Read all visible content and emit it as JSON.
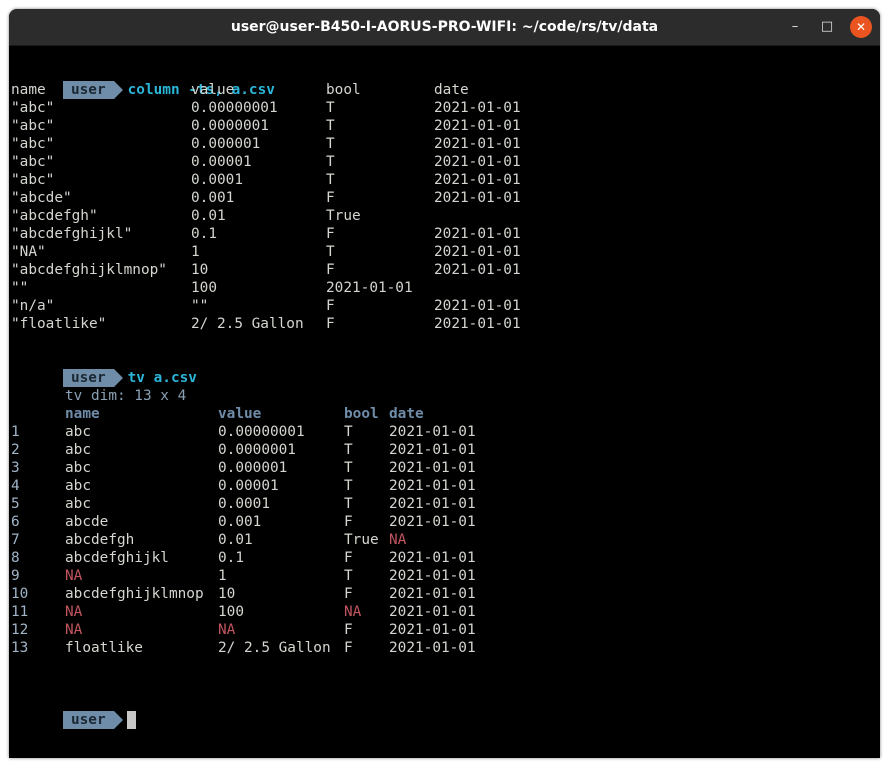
{
  "window": {
    "title": "user@user-B450-I-AORUS-PRO-WIFI: ~/code/rs/tv/data",
    "min_label": "–",
    "max_label": "□",
    "close_label": "✕"
  },
  "prompt": {
    "user": "user"
  },
  "cmd1": "column -ts, a.csv",
  "col_output": {
    "header": [
      "name",
      "value",
      "bool",
      "date"
    ],
    "rows": [
      [
        "\"abc\"",
        "0.00000001",
        "T",
        "2021-01-01"
      ],
      [
        "\"abc\"",
        "0.0000001",
        "T",
        "2021-01-01"
      ],
      [
        "\"abc\"",
        "0.000001",
        "T",
        "2021-01-01"
      ],
      [
        "\"abc\"",
        "0.00001",
        "T",
        "2021-01-01"
      ],
      [
        "\"abc\"",
        "0.0001",
        "T",
        "2021-01-01"
      ],
      [
        "\"abcde\"",
        "0.001",
        "F",
        "2021-01-01"
      ],
      [
        "\"abcdefgh\"",
        "0.01",
        "True",
        ""
      ],
      [
        "\"abcdefghijkl\"",
        "0.1",
        "F",
        "2021-01-01"
      ],
      [
        "\"NA\"",
        "1",
        "T",
        "2021-01-01"
      ],
      [
        "\"abcdefghijklmnop\"",
        "10",
        "F",
        "2021-01-01"
      ],
      [
        "\"\"",
        "100",
        "2021-01-01",
        ""
      ],
      [
        "\"n/a\"",
        "\"\"",
        "F",
        "2021-01-01"
      ],
      [
        "\"floatlike\"",
        "2/ 2.5 Gallon",
        "F",
        "2021-01-01"
      ]
    ]
  },
  "cmd2": "tv a.csv",
  "tv_output": {
    "dim": "tv dim: 13 x 4",
    "header": [
      "name",
      "value",
      "bool",
      "date"
    ],
    "rows": [
      [
        "1",
        "abc",
        "0.00000001",
        "T",
        "2021-01-01"
      ],
      [
        "2",
        "abc",
        "0.0000001",
        "T",
        "2021-01-01"
      ],
      [
        "3",
        "abc",
        "0.000001",
        "T",
        "2021-01-01"
      ],
      [
        "4",
        "abc",
        "0.00001",
        "T",
        "2021-01-01"
      ],
      [
        "5",
        "abc",
        "0.0001",
        "T",
        "2021-01-01"
      ],
      [
        "6",
        "abcde",
        "0.001",
        "F",
        "2021-01-01"
      ],
      [
        "7",
        "abcdefgh",
        "0.01",
        "True",
        "NA"
      ],
      [
        "8",
        "abcdefghijkl",
        "0.1",
        "F",
        "2021-01-01"
      ],
      [
        "9",
        "NA",
        "1",
        "T",
        "2021-01-01"
      ],
      [
        "10",
        "abcdefghijklmnop",
        "10",
        "F",
        "2021-01-01"
      ],
      [
        "11",
        "NA",
        "100",
        "NA",
        "2021-01-01"
      ],
      [
        "12",
        "NA",
        "NA",
        "F",
        "2021-01-01"
      ],
      [
        "13",
        "floatlike",
        "2/ 2.5 Gallon",
        "F",
        "2021-01-01"
      ]
    ],
    "na_token": "NA"
  },
  "colors": {
    "terminal_bg": "#000000",
    "text": "#d3d7cf",
    "command": "#2bb5d8",
    "prompt_badge": "#6f8da9",
    "tv_header": "#6f8da9",
    "na": "#c0555e",
    "close_button": "#e95420"
  }
}
